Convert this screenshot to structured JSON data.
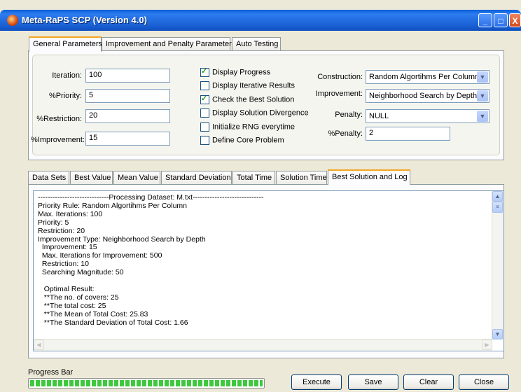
{
  "window": {
    "title": "Meta-RaPS SCP (Version 4.0)"
  },
  "top_tabs": [
    "General Parameters",
    "Improvement and Penalty Parameters",
    "Auto Testing"
  ],
  "params": {
    "iteration_label": "Iteration:",
    "iteration_value": "100",
    "priority_label": "%Priority:",
    "priority_value": "5",
    "restriction_label": "%Restriction:",
    "restriction_value": "20",
    "improvement_label": "%Improvement:",
    "improvement_value": "15"
  },
  "options": [
    {
      "label": "Display Progress",
      "checked": true
    },
    {
      "label": "Display Iterative Results",
      "checked": false
    },
    {
      "label": "Check the Best Solution",
      "checked": true
    },
    {
      "label": "Display Solution Divergence",
      "checked": false
    },
    {
      "label": "Initialize RNG everytime",
      "checked": false
    },
    {
      "label": "Define Core Problem",
      "checked": false
    }
  ],
  "selects": {
    "construction_label": "Construction:",
    "construction_value": "Random Algortihms Per Column",
    "improvement_label": "Improvement:",
    "improvement_value": "Neighborhood Search by Depth",
    "penalty_label": "Penalty:",
    "penalty_value": "NULL",
    "pct_penalty_label": "%Penalty:",
    "pct_penalty_value": "2"
  },
  "result_tabs": [
    "Data Sets",
    "Best Value",
    "Mean Value",
    "Standard Deviation",
    "Total Time",
    "Solution Time",
    "Best Solution and Log"
  ],
  "log_lines": [
    "-----------------------------Processing Dataset: M.txt-----------------------------",
    "Priority Rule: Random Algortihms Per Column",
    "Max. Iterations: 100",
    "Priority: 5",
    "Restriction: 20",
    "Improvement Type: Neighborhood Search by Depth",
    "  Improvement: 15",
    "  Max. Iterations for Improvement: 500",
    "  Restriction: 10",
    "  Searching Magnitude: 50",
    "",
    "   Optimal Result:",
    "   **The no. of covers: 25",
    "   **The total cost: 25",
    "   **The Mean of Total Cost: 25.83",
    "   **The Standard Deviation of Total Cost: 1.66"
  ],
  "progress": {
    "label": "Progress Bar",
    "value": 1.0
  },
  "buttons": {
    "execute": "Execute",
    "save": "Save",
    "clear": "Clear",
    "close": "Close"
  },
  "icons": {
    "app": "app-icon",
    "minimize": "minimize-icon",
    "maximize": "maximize-icon",
    "close": "close-icon"
  }
}
